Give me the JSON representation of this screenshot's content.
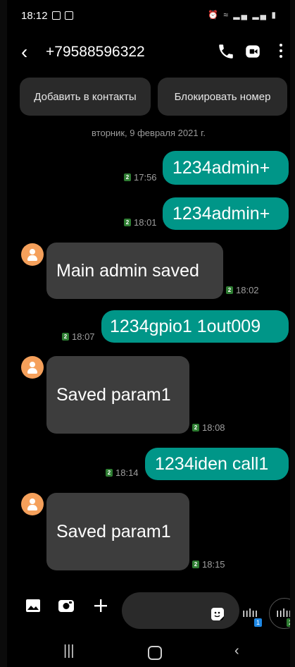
{
  "status_bar": {
    "time": "18:12"
  },
  "header": {
    "phone_number": "+79588596322"
  },
  "actions": {
    "add_contact_label": "Добавить в контакты",
    "block_label": "Блокировать номер"
  },
  "date_divider": "вторник, 9 февраля 2021 г.",
  "messages": [
    {
      "direction": "out",
      "sim": "2",
      "time": "17:56",
      "text": "1234admin+"
    },
    {
      "direction": "out",
      "sim": "2",
      "time": "18:01",
      "text": "1234admin+"
    },
    {
      "direction": "in",
      "sim": "2",
      "time": "18:02",
      "text": "Main admin saved"
    },
    {
      "direction": "out",
      "sim": "2",
      "time": "18:07",
      "text": "1234gpio1 1out009"
    },
    {
      "direction": "in",
      "sim": "2",
      "time": "18:08",
      "text": "Saved param1"
    },
    {
      "direction": "out",
      "sim": "2",
      "time": "18:14",
      "text": "1234iden call1"
    },
    {
      "direction": "in",
      "sim": "2",
      "time": "18:15",
      "text": "Saved param1"
    }
  ],
  "composer": {
    "voice_sim1_badge": "1",
    "voice_sim2_badge": "2"
  },
  "icons": {
    "back": "back-arrow-icon",
    "call": "phone-icon",
    "video": "video-call-icon",
    "menu": "more-vert-icon",
    "gallery": "image-icon",
    "camera": "camera-icon",
    "add": "plus-icon",
    "sticker": "sticker-icon",
    "voice": "voice-wave-icon"
  },
  "colors": {
    "outgoing_bubble": "#009688",
    "incoming_bubble": "#3d3d3d",
    "avatar": "#f5a05b",
    "sim_badge": "#2e7d32"
  }
}
